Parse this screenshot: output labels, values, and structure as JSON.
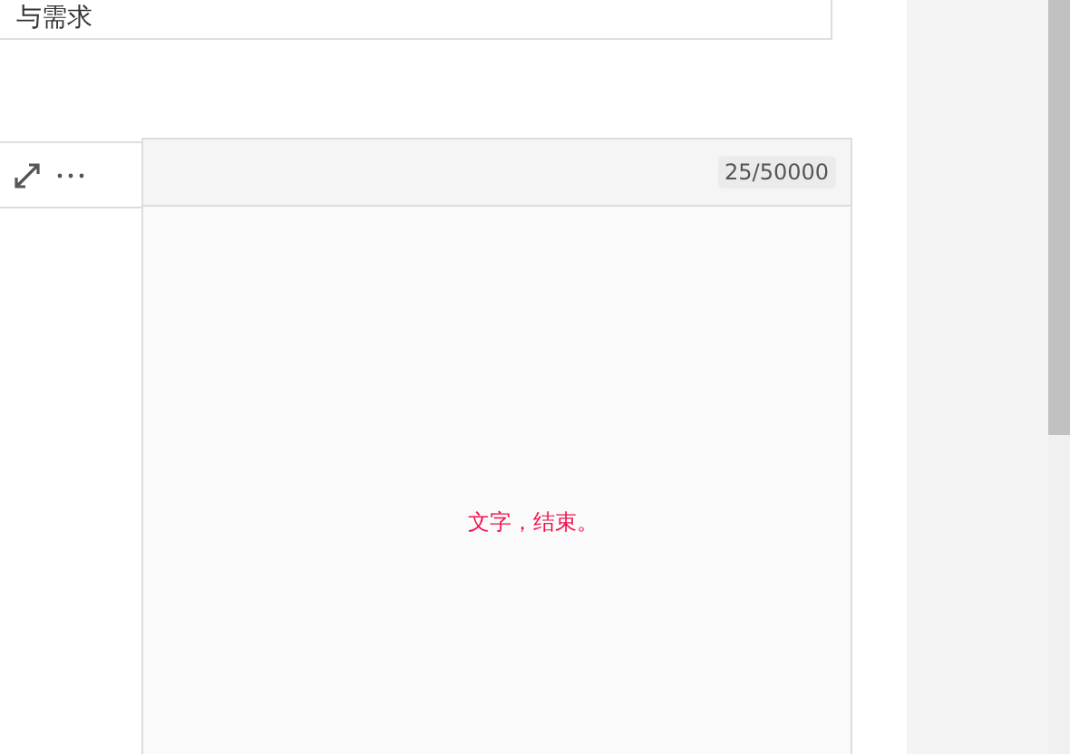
{
  "title_field": {
    "value": "与需求"
  },
  "editor": {
    "counter": "25/50000",
    "content": "文字，结束。"
  }
}
